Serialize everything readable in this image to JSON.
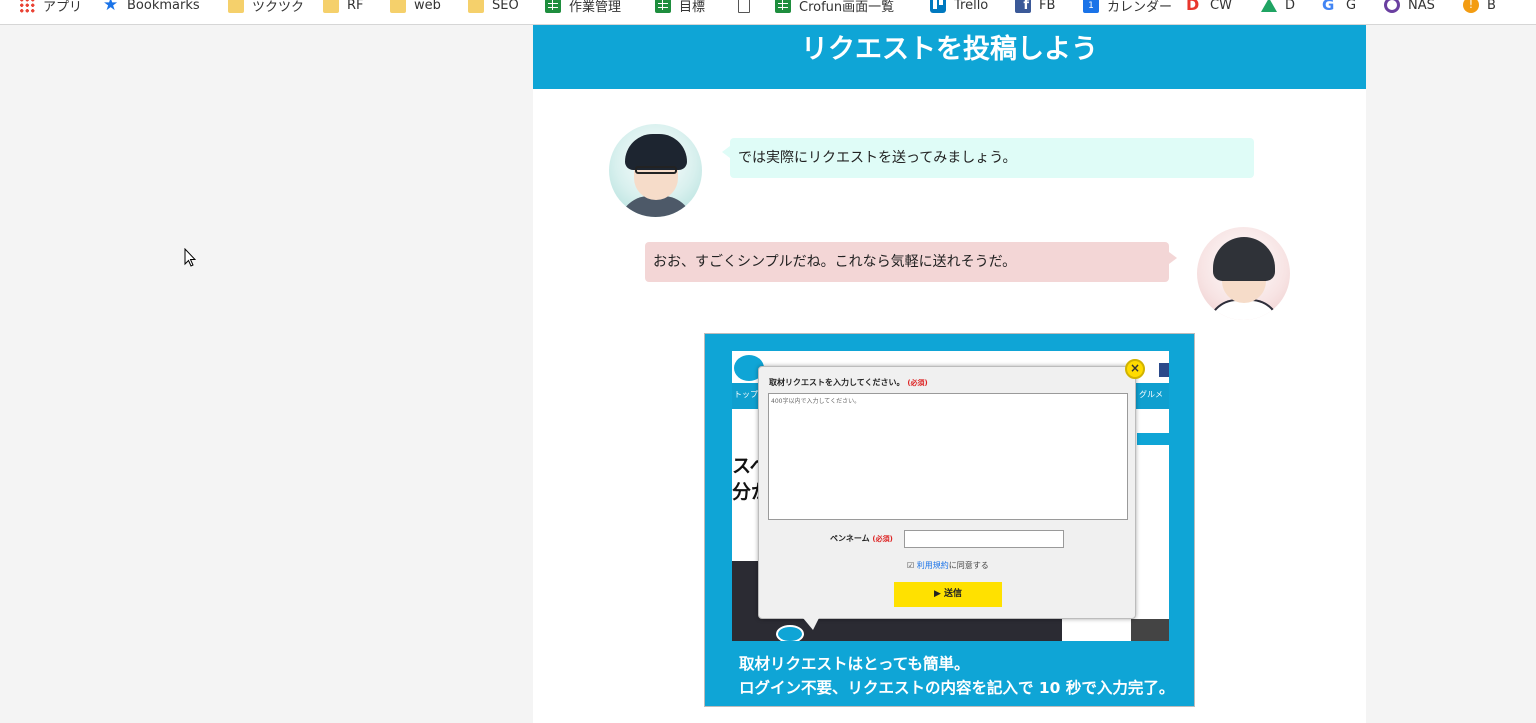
{
  "bookmarks": [
    {
      "label": "アプリ",
      "icon": "apps-icon"
    },
    {
      "label": "Bookmarks",
      "icon": "star-icon"
    },
    {
      "label": "ツクツク",
      "icon": "folder-icon"
    },
    {
      "label": "RF",
      "icon": "folder-icon"
    },
    {
      "label": "web",
      "icon": "folder-icon"
    },
    {
      "label": "SEO",
      "icon": "folder-icon"
    },
    {
      "label": "作業管理",
      "icon": "sheets-icon"
    },
    {
      "label": "目標",
      "icon": "sheets-icon"
    },
    {
      "label": "",
      "icon": "page-icon"
    },
    {
      "label": "Crofun画面一覧",
      "icon": "sheets-icon"
    },
    {
      "label": "Trello",
      "icon": "trello-icon"
    },
    {
      "label": "FB",
      "icon": "facebook-icon"
    },
    {
      "label": "カレンダー",
      "icon": "calendar-icon"
    },
    {
      "label": "CW",
      "icon": "chatwork-icon"
    },
    {
      "label": "D",
      "icon": "drive-icon"
    },
    {
      "label": "G",
      "icon": "google-icon"
    },
    {
      "label": "NAS",
      "icon": "nas-icon"
    },
    {
      "label": "B",
      "icon": "b-icon"
    }
  ],
  "banner": {
    "title": "リクエストを投稿しよう"
  },
  "chat": {
    "message1": "では実際にリクエストを送ってみましょう。",
    "message2": "おお、すごくシンプルだね。これなら気軽に送れそうだ。"
  },
  "figure": {
    "modal": {
      "request_label": "取材リクエストを入力してください。",
      "required": "(必須)",
      "textarea_placeholder": "400字以内で入力してください。",
      "penname_label": "ペンネーム",
      "terms_link": "利用規約",
      "terms_suffix": "に同意する",
      "submit_label": "▶ 送信",
      "close_glyph": "×"
    },
    "background": {
      "nav_left": "トップ",
      "nav_right": "グルメ",
      "headline": "スペ\n分か"
    },
    "caption_line1": "取材リクエストはとっても簡単。",
    "caption_line2": "ログイン不要、リクエストの内容を記入で 10 秒で入力完了。"
  },
  "colors": {
    "accent": "#0fa5d6",
    "bubble_teal": "#dffcf7",
    "bubble_pink": "#f3d6d6",
    "submit_yellow": "#ffe100"
  }
}
